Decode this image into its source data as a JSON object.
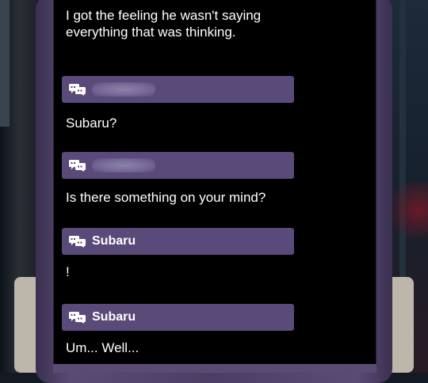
{
  "narration": {
    "line1": "I got the feeling he wasn't saying",
    "line2": "everything that was thinking."
  },
  "entries": [
    {
      "speaker": "",
      "speaker_hidden": true,
      "text": "Subaru?"
    },
    {
      "speaker": "",
      "speaker_hidden": true,
      "text": "Is there something on your mind?"
    },
    {
      "speaker": "Subaru",
      "speaker_hidden": false,
      "text": "!"
    },
    {
      "speaker": "Subaru",
      "speaker_hidden": false,
      "text": "Um... Well..."
    }
  ],
  "icons": {
    "speaker": "speech-bubbles-icon"
  },
  "colors": {
    "panel_background": "#000000",
    "speaker_bar": "#5a4a7a",
    "frame": "#4b3e63",
    "text": "#ffffff"
  }
}
